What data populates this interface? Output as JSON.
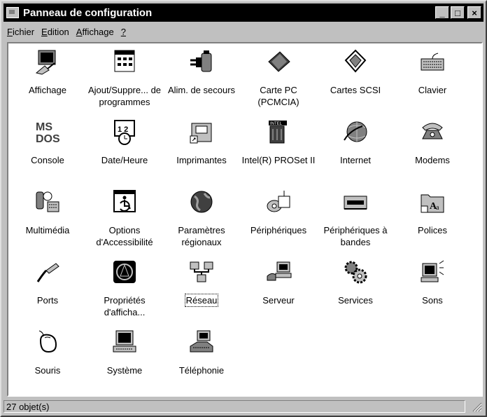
{
  "window": {
    "title": "Panneau de configuration",
    "buttons": {
      "minimize": "_",
      "maximize": "□",
      "close": "×"
    }
  },
  "menu": [
    {
      "label": "Fichier",
      "key": "F",
      "rest": "ichier"
    },
    {
      "label": "Edition",
      "key": "E",
      "rest": "dition"
    },
    {
      "label": "Affichage",
      "key": "A",
      "rest": "ffichage"
    },
    {
      "label": "?",
      "key": "?",
      "rest": ""
    }
  ],
  "items": [
    {
      "label": "Affichage",
      "icon": "display-icon"
    },
    {
      "label": "Ajout/Suppre... de programmes",
      "icon": "add-remove-programs-icon"
    },
    {
      "label": "Alim. de secours",
      "icon": "ups-power-icon"
    },
    {
      "label": "Carte PC (PCMCIA)",
      "icon": "pc-card-icon"
    },
    {
      "label": "Cartes SCSI",
      "icon": "scsi-icon"
    },
    {
      "label": "Clavier",
      "icon": "keyboard-icon"
    },
    {
      "label": "Console",
      "icon": "msdos-console-icon"
    },
    {
      "label": "Date/Heure",
      "icon": "date-time-icon"
    },
    {
      "label": "Imprimantes",
      "icon": "printers-icon"
    },
    {
      "label": "Intel(R) PROSet II",
      "icon": "intel-proset-icon"
    },
    {
      "label": "Internet",
      "icon": "internet-icon"
    },
    {
      "label": "Modems",
      "icon": "modem-phone-icon"
    },
    {
      "label": "Multimédia",
      "icon": "multimedia-icon"
    },
    {
      "label": "Options d'Accessibilité",
      "icon": "accessibility-icon"
    },
    {
      "label": "Paramètres régionaux",
      "icon": "globe-icon"
    },
    {
      "label": "Périphériques",
      "icon": "devices-icon"
    },
    {
      "label": "Périphériques à bandes",
      "icon": "tape-devices-icon"
    },
    {
      "label": "Polices",
      "icon": "fonts-folder-icon"
    },
    {
      "label": "Ports",
      "icon": "ports-cable-icon"
    },
    {
      "label": "Propriétés d'afficha...",
      "icon": "display-properties-icon"
    },
    {
      "label": "Réseau",
      "icon": "network-icon",
      "focused": true
    },
    {
      "label": "Serveur",
      "icon": "server-icon"
    },
    {
      "label": "Services",
      "icon": "services-gears-icon"
    },
    {
      "label": "Sons",
      "icon": "sounds-icon"
    },
    {
      "label": "Souris",
      "icon": "mouse-icon"
    },
    {
      "label": "Système",
      "icon": "system-computer-icon"
    },
    {
      "label": "Téléphonie",
      "icon": "telephony-icon"
    }
  ],
  "status": {
    "text": "27 objet(s)"
  }
}
